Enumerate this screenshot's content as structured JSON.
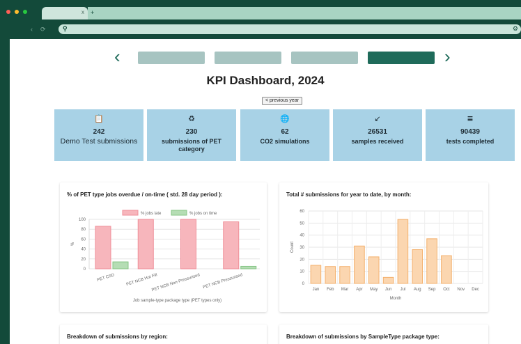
{
  "browser": {
    "dot_colors": [
      "#ff5f57",
      "#febc2e",
      "#28c840"
    ],
    "tab_close": "x",
    "new_tab": "+"
  },
  "page": {
    "title": "KPI Dashboard, 2024",
    "previous_year_button": "< previous year",
    "pager": {
      "prev_arrow": "‹",
      "next_arrow": "›",
      "pill_colors": [
        "#a7c4c1",
        "#a7c4c1",
        "#a7c4c1",
        "#1f6b5a"
      ],
      "active_index": 3
    }
  },
  "kpis": [
    {
      "icon": "clipboard-icon",
      "glyph": "📋",
      "value": "242",
      "label": "Demo Test submissions"
    },
    {
      "icon": "recycle-icon",
      "glyph": "♻",
      "value": "230",
      "label": "submissions of PET category"
    },
    {
      "icon": "globe-icon",
      "glyph": "🌐",
      "value": "62",
      "label": "CO2 simulations"
    },
    {
      "icon": "arrow-down-left-icon",
      "glyph": "↙",
      "value": "26531",
      "label": "samples received"
    },
    {
      "icon": "list-icon",
      "glyph": "≣",
      "value": "90439",
      "label": "tests completed"
    }
  ],
  "cards": {
    "overdue_title": "% of PET type jobs overdue / on-time ( std. 28 day period ):",
    "monthly_title": "Total # submissions for year to date, by month:",
    "region_title": "Breakdown of submissions by region:",
    "sampletype_title": "Breakdown of submissions by SampleType package type:"
  },
  "chart_data": [
    {
      "type": "bar",
      "title": "% of PET type jobs overdue / on-time ( std. 28 day period ):",
      "categories": [
        "PET CSD",
        "PET NCB Hot Fill",
        "PET NCB Non-Pressurised",
        "PET NCB Pressurised"
      ],
      "series": [
        {
          "name": "% jobs late",
          "values": [
            86,
            100,
            100,
            95
          ],
          "color": "#f7b6bc",
          "stroke": "#ef8e98"
        },
        {
          "name": "% jobs on time",
          "values": [
            14,
            0,
            0,
            5
          ],
          "color": "#b5ddb4",
          "stroke": "#86c585"
        }
      ],
      "xlabel": "Job sample-type package type (PET types only)",
      "ylabel": "%",
      "ylim": [
        0,
        100
      ],
      "yticks": [
        0,
        20,
        40,
        60,
        80,
        100
      ],
      "grid": true,
      "legend": "top"
    },
    {
      "type": "bar",
      "title": "Total # submissions for year to date, by month:",
      "categories": [
        "Jan",
        "Feb",
        "Mar",
        "Apr",
        "May",
        "Jun",
        "Jul",
        "Aug",
        "Sep",
        "Oct",
        "Nov",
        "Dec"
      ],
      "values": [
        15,
        14,
        14,
        31,
        22,
        5,
        53,
        28,
        37,
        23,
        0,
        0
      ],
      "color": "#fbd6b0",
      "stroke": "#f4b06c",
      "xlabel": "Month",
      "ylabel": "Count",
      "ylim": [
        0,
        60
      ],
      "yticks": [
        0,
        10,
        20,
        30,
        40,
        50,
        60
      ],
      "grid": true
    }
  ]
}
